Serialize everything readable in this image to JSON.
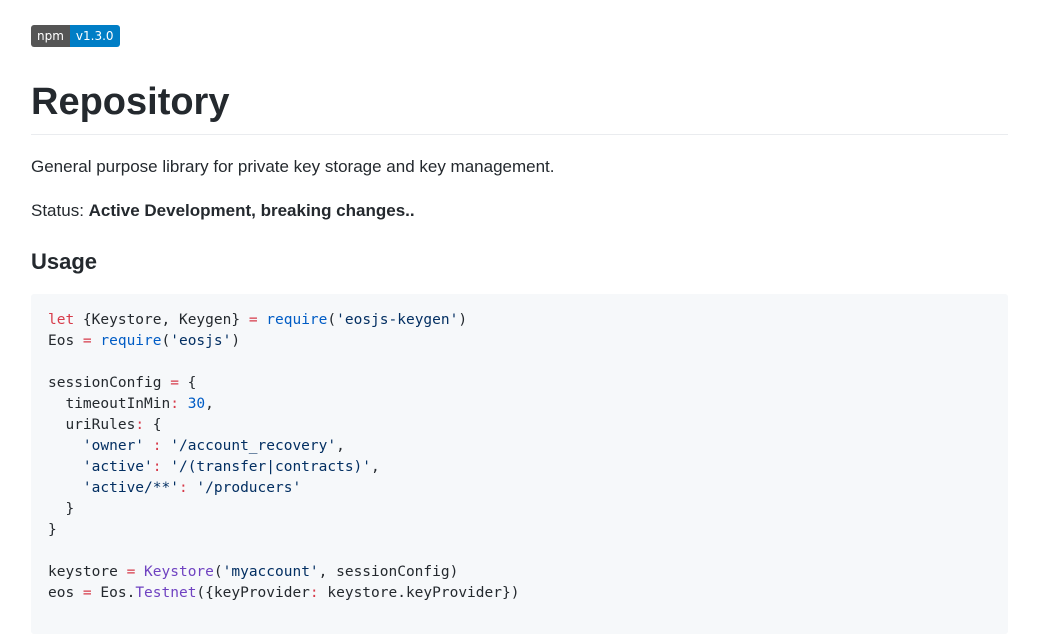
{
  "badge": {
    "label": "npm",
    "version": "v1.3.0"
  },
  "title": "Repository",
  "description": "General purpose library for private key storage and key management.",
  "status": {
    "label": "Status:",
    "value": "Active Development, breaking changes.."
  },
  "usage_heading": "Usage",
  "code_lines": [
    [
      {
        "t": "let",
        "c": "kw"
      },
      {
        "t": " {Keystore, Keygen} "
      },
      {
        "t": "=",
        "c": "op"
      },
      {
        "t": " "
      },
      {
        "t": "require",
        "c": "fn"
      },
      {
        "t": "("
      },
      {
        "t": "'eosjs-keygen'",
        "c": "str"
      },
      {
        "t": ")"
      }
    ],
    [
      {
        "t": "Eos "
      },
      {
        "t": "=",
        "c": "op"
      },
      {
        "t": " "
      },
      {
        "t": "require",
        "c": "fn"
      },
      {
        "t": "("
      },
      {
        "t": "'eosjs'",
        "c": "str"
      },
      {
        "t": ")"
      }
    ],
    [],
    [
      {
        "t": "sessionConfig "
      },
      {
        "t": "=",
        "c": "op"
      },
      {
        "t": " {"
      }
    ],
    [
      {
        "t": "  timeoutInMin"
      },
      {
        "t": ":",
        "c": "op"
      },
      {
        "t": " "
      },
      {
        "t": "30",
        "c": "num"
      },
      {
        "t": ","
      }
    ],
    [
      {
        "t": "  uriRules"
      },
      {
        "t": ":",
        "c": "op"
      },
      {
        "t": " {"
      }
    ],
    [
      {
        "t": "    "
      },
      {
        "t": "'owner'",
        "c": "str"
      },
      {
        "t": " "
      },
      {
        "t": ":",
        "c": "op"
      },
      {
        "t": " "
      },
      {
        "t": "'/account_recovery'",
        "c": "str"
      },
      {
        "t": ","
      }
    ],
    [
      {
        "t": "    "
      },
      {
        "t": "'active'",
        "c": "str"
      },
      {
        "t": ":",
        "c": "op"
      },
      {
        "t": " "
      },
      {
        "t": "'/(transfer|contracts)'",
        "c": "str"
      },
      {
        "t": ","
      }
    ],
    [
      {
        "t": "    "
      },
      {
        "t": "'active/**'",
        "c": "str"
      },
      {
        "t": ":",
        "c": "op"
      },
      {
        "t": " "
      },
      {
        "t": "'/producers'",
        "c": "str"
      }
    ],
    [
      {
        "t": "  }"
      }
    ],
    [
      {
        "t": "}"
      }
    ],
    [],
    [
      {
        "t": "keystore "
      },
      {
        "t": "=",
        "c": "op"
      },
      {
        "t": " "
      },
      {
        "t": "Keystore",
        "c": "cls"
      },
      {
        "t": "("
      },
      {
        "t": "'myaccount'",
        "c": "str"
      },
      {
        "t": ", sessionConfig)"
      }
    ],
    [
      {
        "t": "eos "
      },
      {
        "t": "=",
        "c": "op"
      },
      {
        "t": " Eos."
      },
      {
        "t": "Testnet",
        "c": "cls"
      },
      {
        "t": "({keyProvider"
      },
      {
        "t": ":",
        "c": "op"
      },
      {
        "t": " keystore.keyProvider})"
      }
    ]
  ],
  "colors": {
    "keyword": "#d73a49",
    "function": "#005cc5",
    "string": "#032f62",
    "class": "#6f42c1",
    "badge_left": "#555555",
    "badge_right": "#007ec6",
    "code_background": "#f6f8fa"
  }
}
